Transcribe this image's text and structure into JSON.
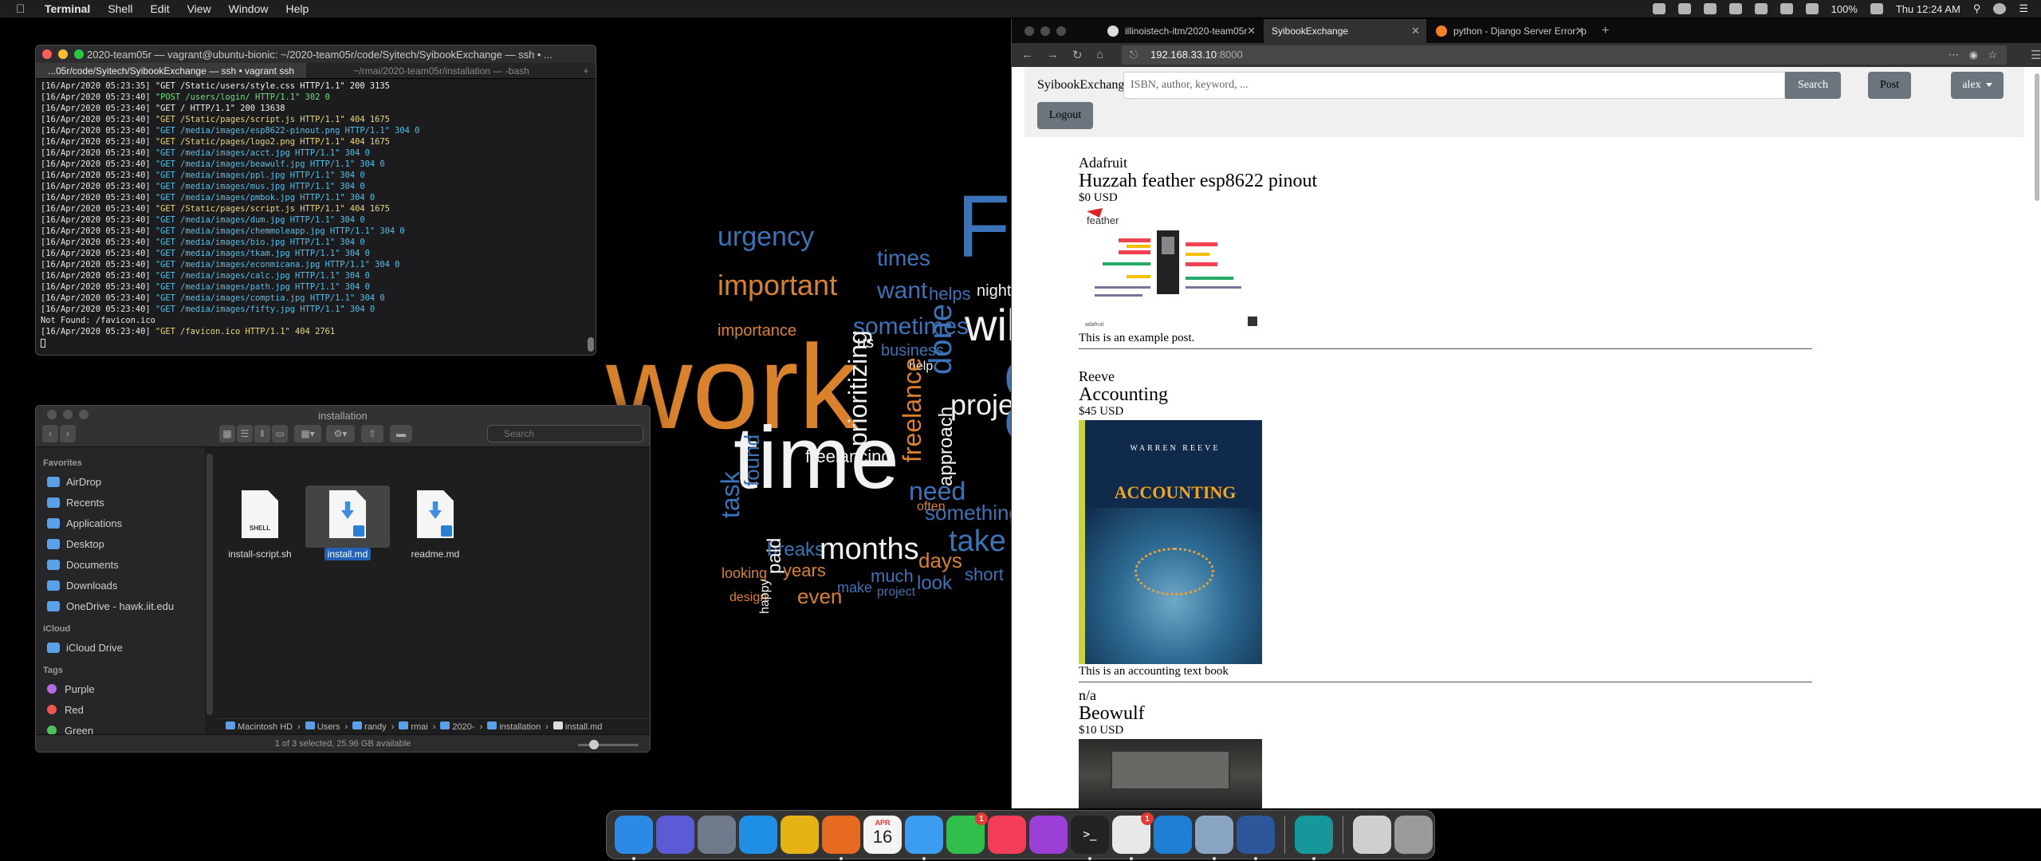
{
  "menubar": {
    "app": "Terminal",
    "items": [
      "Shell",
      "Edit",
      "View",
      "Window",
      "Help"
    ],
    "battery": "100%",
    "clock": "Thu 12:24 AM"
  },
  "wordcloud": [
    {
      "t": "work",
      "c": "#d9822b"
    },
    {
      "t": "time",
      "c": "#f2f2f2"
    },
    {
      "t": "Fr",
      "c": "#3a73b8"
    },
    {
      "t": "will",
      "c": "#f2f2f2"
    },
    {
      "t": "urgency",
      "c": "#3a73b8"
    },
    {
      "t": "important",
      "c": "#d9822b"
    },
    {
      "t": "times",
      "c": "#3a73b8"
    },
    {
      "t": "want",
      "c": "#3a73b8"
    },
    {
      "t": "helps",
      "c": "#3a73b8"
    },
    {
      "t": "night",
      "c": "#f2f2f2"
    },
    {
      "t": "sometimes",
      "c": "#3a73b8"
    },
    {
      "t": "importance",
      "c": "#d9822b"
    },
    {
      "t": "business",
      "c": "#3a73b8"
    },
    {
      "t": "done",
      "c": "#3a73b8"
    },
    {
      "t": "projects",
      "c": "#f2f2f2"
    },
    {
      "t": "help",
      "c": "#f2f2f2"
    },
    {
      "t": "prioritizing",
      "c": "#f2f2f2"
    },
    {
      "t": "freelance",
      "c": "#d9822b"
    },
    {
      "t": "freelancing",
      "c": "#f2f2f2"
    },
    {
      "t": "approach",
      "c": "#f2f2f2"
    },
    {
      "t": "task",
      "c": "#3a73b8"
    },
    {
      "t": "found",
      "c": "#3a73b8"
    },
    {
      "t": "something",
      "c": "#3a73b8"
    },
    {
      "t": "breaks",
      "c": "#3a73b8"
    },
    {
      "t": "months",
      "c": "#f2f2f2"
    },
    {
      "t": "take",
      "c": "#3a73b8"
    },
    {
      "t": "days",
      "c": "#d9822b"
    },
    {
      "t": "years",
      "c": "#d9822b"
    },
    {
      "t": "much",
      "c": "#3a73b8"
    },
    {
      "t": "short",
      "c": "#3a73b8"
    },
    {
      "t": "look",
      "c": "#3a73b8"
    },
    {
      "t": "even",
      "c": "#d9822b"
    },
    {
      "t": "project",
      "c": "#3a73b8"
    },
    {
      "t": "looking",
      "c": "#d9822b"
    },
    {
      "t": "paid",
      "c": "#f2f2f2"
    },
    {
      "t": "need",
      "c": "#3a73b8"
    },
    {
      "t": "often",
      "c": "#d9822b"
    },
    {
      "t": "design",
      "c": "#d9822b"
    },
    {
      "t": "happy",
      "c": "#f2f2f2"
    },
    {
      "t": "make",
      "c": "#3a73b8"
    },
    {
      "t": "us",
      "c": "#f2f2f2"
    },
    {
      "t": "ca",
      "c": "#3a73b8"
    }
  ],
  "terminal": {
    "title": "2020-team05r — vagrant@ubuntu-bionic: ~/2020-team05r/code/Syitech/SyibookExchange — ssh • ...",
    "tabs": [
      "...05r/code/Syitech/SyibookExchange — ssh • vagrant ssh",
      "~/rmai/2020-team05r/installation — -bash"
    ],
    "lines": [
      {
        "ts": "[16/Apr/2020 05:23:35]",
        "req": "\"GET /Static/users/style.css HTTP/1.1\" 200 3135",
        "code": "200"
      },
      {
        "ts": "[16/Apr/2020 05:23:40]",
        "req": "\"POST /users/login/ HTTP/1.1\" 302 0",
        "code": "302"
      },
      {
        "ts": "[16/Apr/2020 05:23:40]",
        "req": "\"GET / HTTP/1.1\" 200 13638",
        "code": "200"
      },
      {
        "ts": "[16/Apr/2020 05:23:40]",
        "req": "\"GET /Static/pages/script.js HTTP/1.1\" 404 1675",
        "code": "404"
      },
      {
        "ts": "[16/Apr/2020 05:23:40]",
        "req": "\"GET /media/images/esp8622-pinout.png HTTP/1.1\" 304 0",
        "code": "304"
      },
      {
        "ts": "[16/Apr/2020 05:23:40]",
        "req": "\"GET /Static/pages/logo2.png HTTP/1.1\" 404 1675",
        "code": "404"
      },
      {
        "ts": "[16/Apr/2020 05:23:40]",
        "req": "\"GET /media/images/acct.jpg HTTP/1.1\" 304 0",
        "code": "304"
      },
      {
        "ts": "[16/Apr/2020 05:23:40]",
        "req": "\"GET /media/images/beawulf.jpg HTTP/1.1\" 304 0",
        "code": "304"
      },
      {
        "ts": "[16/Apr/2020 05:23:40]",
        "req": "\"GET /media/images/ppl.jpg HTTP/1.1\" 304 0",
        "code": "304"
      },
      {
        "ts": "[16/Apr/2020 05:23:40]",
        "req": "\"GET /media/images/mus.jpg HTTP/1.1\" 304 0",
        "code": "304"
      },
      {
        "ts": "[16/Apr/2020 05:23:40]",
        "req": "\"GET /media/images/pmbok.jpg HTTP/1.1\" 304 0",
        "code": "304"
      },
      {
        "ts": "[16/Apr/2020 05:23:40]",
        "req": "\"GET /Static/pages/script.js HTTP/1.1\" 404 1675",
        "code": "404"
      },
      {
        "ts": "[16/Apr/2020 05:23:40]",
        "req": "\"GET /media/images/dum.jpg HTTP/1.1\" 304 0",
        "code": "304"
      },
      {
        "ts": "[16/Apr/2020 05:23:40]",
        "req": "\"GET /media/images/chemmoleapp.jpg HTTP/1.1\" 304 0",
        "code": "304"
      },
      {
        "ts": "[16/Apr/2020 05:23:40]",
        "req": "\"GET /media/images/bio.jpg HTTP/1.1\" 304 0",
        "code": "304"
      },
      {
        "ts": "[16/Apr/2020 05:23:40]",
        "req": "\"GET /media/images/tkam.jpg HTTP/1.1\" 304 0",
        "code": "304"
      },
      {
        "ts": "[16/Apr/2020 05:23:40]",
        "req": "\"GET /media/images/econmicana.jpg HTTP/1.1\" 304 0",
        "code": "304"
      },
      {
        "ts": "[16/Apr/2020 05:23:40]",
        "req": "\"GET /media/images/calc.jpg HTTP/1.1\" 304 0",
        "code": "304"
      },
      {
        "ts": "[16/Apr/2020 05:23:40]",
        "req": "\"GET /media/images/path.jpg HTTP/1.1\" 304 0",
        "code": "304"
      },
      {
        "ts": "[16/Apr/2020 05:23:40]",
        "req": "\"GET /media/images/comptia.jpg HTTP/1.1\" 304 0",
        "code": "304"
      },
      {
        "ts": "[16/Apr/2020 05:23:40]",
        "req": "\"GET /media/images/fifty.jpg HTTP/1.1\" 304 0",
        "code": "304"
      },
      {
        "ts": "",
        "req": "Not Found: /favicon.ico",
        "code": "plain"
      },
      {
        "ts": "[16/Apr/2020 05:23:40]",
        "req": "\"GET /favicon.ico HTTP/1.1\" 404 2761",
        "code": "404"
      }
    ]
  },
  "finder": {
    "title": "installation",
    "search_placeholder": "Search",
    "sidebar": {
      "favorites_label": "Favorites",
      "favorites": [
        "AirDrop",
        "Recents",
        "Applications",
        "Desktop",
        "Documents",
        "Downloads",
        "OneDrive - hawk.iit.edu"
      ],
      "icloud_label": "iCloud",
      "icloud": [
        "iCloud Drive"
      ],
      "tags_label": "Tags",
      "tags": [
        {
          "name": "Purple",
          "color": "#b36ae2"
        },
        {
          "name": "Red",
          "color": "#f0544f"
        },
        {
          "name": "Green",
          "color": "#4cc45c"
        }
      ]
    },
    "files": [
      {
        "name": "install-script.sh",
        "label": "SHELL"
      },
      {
        "name": "install.md",
        "label": ""
      },
      {
        "name": "readme.md",
        "label": ""
      }
    ],
    "path": [
      "Macintosh HD",
      "Users",
      "randy",
      "rmai",
      "2020-",
      "installation",
      "install.md"
    ],
    "status": "1 of 3 selected, 25.96 GB available"
  },
  "firefox": {
    "tabs": [
      {
        "title": "illinoistech-itm/2020-team05r"
      },
      {
        "title": "SyibookExchange"
      },
      {
        "title": "python - Django Server Error: p"
      }
    ],
    "url_host": "192.168.33.10",
    "url_port": ":8000"
  },
  "site": {
    "brand": "SyibookExchange",
    "search_placeholder": "ISBN, author, keyword, ...",
    "search_label": "Search",
    "post_label": "Post",
    "user_label": "alex",
    "logout_label": "Logout",
    "posts": [
      {
        "author": "Adafruit",
        "title": "Huzzah feather esp8622 pinout",
        "price": "$0 USD",
        "desc": "This is an example post.",
        "cover_title": "",
        "cover_authors": ""
      },
      {
        "author": "Reeve",
        "title": "Accounting",
        "price": "$45 USD",
        "desc": "This is an accounting text book",
        "cover_title": "ACCOUNTING",
        "cover_authors": "WARREN   REEVE"
      },
      {
        "author": "n/a",
        "title": "Beowulf",
        "price": "$10 USD",
        "desc": "",
        "cover_title": "",
        "cover_authors": ""
      }
    ]
  },
  "dock": {
    "apps": [
      {
        "name": "finder",
        "color": "#2a8ae6",
        "running": true,
        "badge": ""
      },
      {
        "name": "siri",
        "color": "#5b5bd6",
        "running": false,
        "badge": ""
      },
      {
        "name": "launchpad",
        "color": "#6f7b8a",
        "running": false,
        "badge": ""
      },
      {
        "name": "safari",
        "color": "#1f8fe6",
        "running": false,
        "badge": ""
      },
      {
        "name": "chrome",
        "color": "#e7b214",
        "running": false,
        "badge": ""
      },
      {
        "name": "firefox",
        "color": "#e66a1f",
        "running": true,
        "badge": ""
      },
      {
        "name": "calendar",
        "color": "#f4f4f4",
        "running": false,
        "badge": ""
      },
      {
        "name": "messages",
        "color": "#3a9df0",
        "running": true,
        "badge": ""
      },
      {
        "name": "facetime",
        "color": "#2fbf4a",
        "running": false,
        "badge": "1"
      },
      {
        "name": "music",
        "color": "#f23c58",
        "running": false,
        "badge": ""
      },
      {
        "name": "podcasts",
        "color": "#9b3fd6",
        "running": false,
        "badge": ""
      },
      {
        "name": "terminal",
        "color": "#222222",
        "running": true,
        "badge": ""
      },
      {
        "name": "slack",
        "color": "#e8e8e8",
        "running": true,
        "badge": "1"
      },
      {
        "name": "vscode",
        "color": "#1f7fd4",
        "running": false,
        "badge": ""
      },
      {
        "name": "preview",
        "color": "#8aa4c4",
        "running": true,
        "badge": ""
      },
      {
        "name": "word",
        "color": "#2b579a",
        "running": true,
        "badge": ""
      },
      {
        "name": "arduino",
        "color": "#15979c",
        "running": true,
        "badge": ""
      }
    ],
    "calendar_month": "APR",
    "calendar_day": "16"
  }
}
